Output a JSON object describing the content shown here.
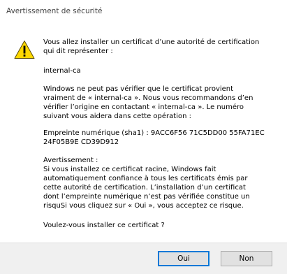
{
  "window": {
    "title": "Avertissement de sécurité"
  },
  "icon": {
    "name": "warning-icon",
    "fill": "#ffd800",
    "stroke": "#5a4a00"
  },
  "message": {
    "intro": "Vous allez installer un certificat d’une autorité de certification\nqui dit représenter :",
    "ca_name": "internal-ca",
    "verify": "Windows ne peut pas vérifier que le certificat provient\nvraiment de « internal-ca ». Nous vous recommandons d’en\nvérifier l’origine en contactant « internal-ca ». Le numéro\nsuivant vous aidera dans cette opération :",
    "thumbprint": "Empreinte numérique (sha1) : 9ACC6F56 71C5DD00 55FA71EC\n24F05B9E CD39D912",
    "warning_heading": "Avertissement :",
    "warning_body": "Si vous installez ce certificat racine, Windows fait\nautomatiquement confiance à tous les certificats émis par\ncette autorité de certification. L’installation d’un certificat\ndont l’empreinte numérique n’est pas vérifiée constitue un\nrisqu",
    "warning_body_tail": "Si vous cliquez sur « Oui », vous acceptez ce risque.",
    "question": "Voulez-vous installer ce certificat ?"
  },
  "buttons": {
    "yes": "Oui",
    "no": "Non"
  },
  "colors": {
    "footer_bg": "#f0f0f0",
    "focus_border": "#0078d7"
  }
}
